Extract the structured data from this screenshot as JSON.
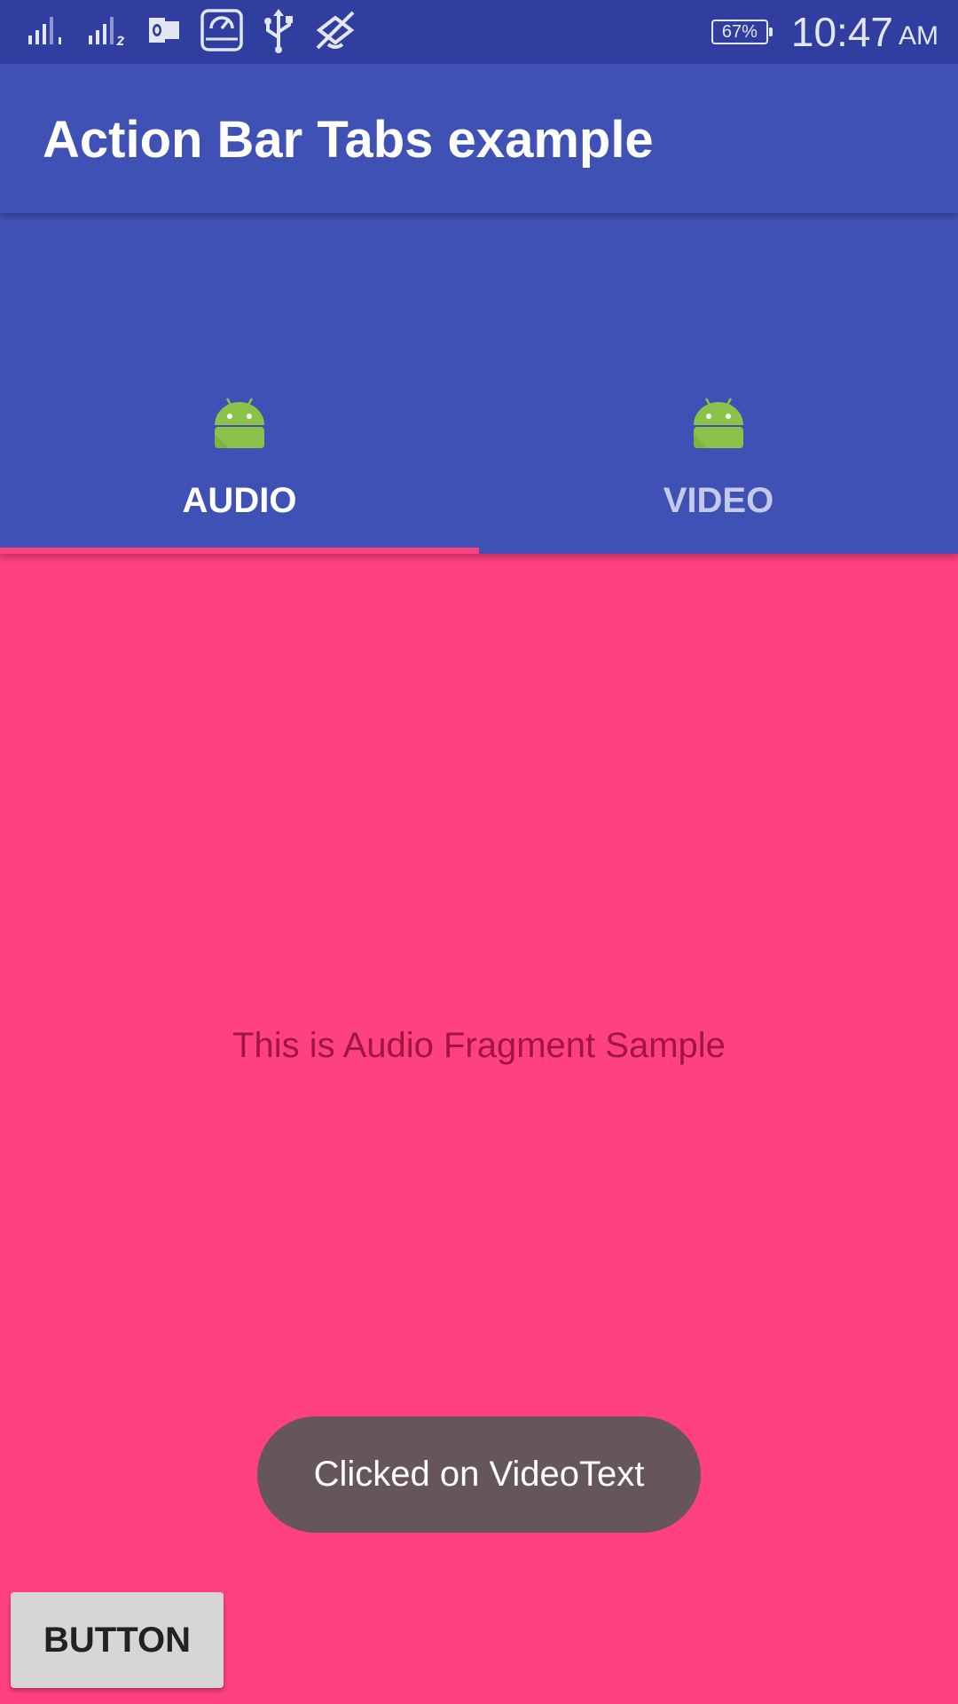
{
  "status_bar": {
    "icons": [
      "signal-sim1-icon",
      "signal-sim2-icon",
      "outlook-icon",
      "storage-sync-icon",
      "usb-icon",
      "mute-icon"
    ],
    "battery": "67%",
    "time": "10:47",
    "ampm": "AM"
  },
  "app_bar": {
    "title": "Action Bar Tabs example"
  },
  "tabs": [
    {
      "label": "AUDIO",
      "icon": "android-icon",
      "selected": true
    },
    {
      "label": "VIDEO",
      "icon": "android-icon",
      "selected": false
    }
  ],
  "content": {
    "fragment_text": "This is Audio Fragment Sample"
  },
  "toast": {
    "message": "Clicked on VideoText"
  },
  "button": {
    "label": "BUTTON"
  },
  "colors": {
    "status_bar": "#303f9f",
    "primary": "#3f51b5",
    "accent": "#ff4081",
    "android_green": "#8bc34a"
  }
}
